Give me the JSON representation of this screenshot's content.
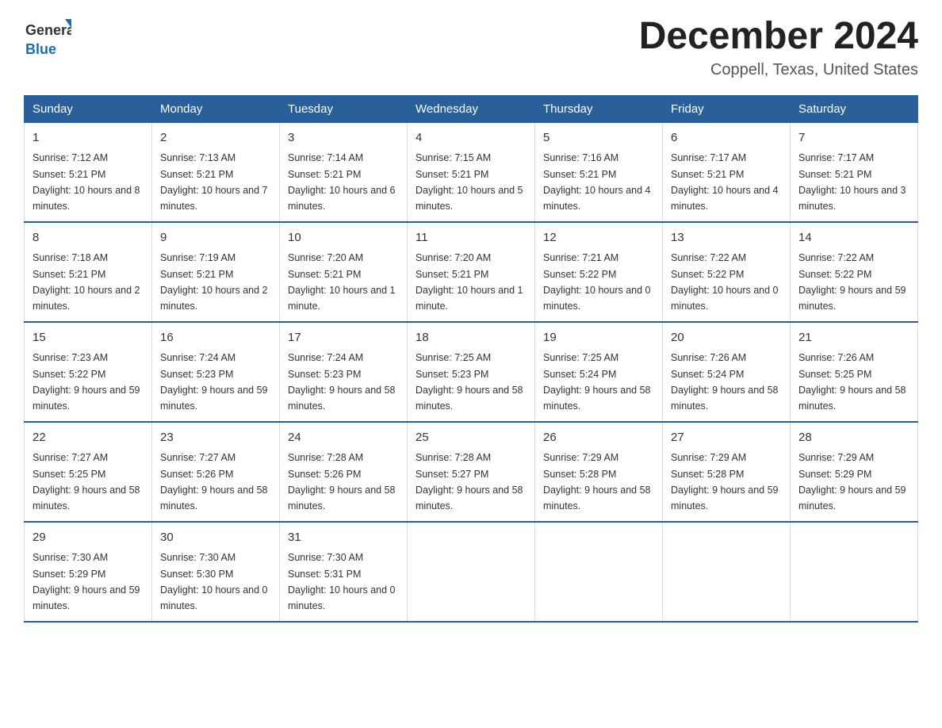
{
  "logo": {
    "general": "General",
    "blue": "Blue"
  },
  "title": {
    "month_year": "December 2024",
    "location": "Coppell, Texas, United States"
  },
  "header": {
    "days": [
      "Sunday",
      "Monday",
      "Tuesday",
      "Wednesday",
      "Thursday",
      "Friday",
      "Saturday"
    ]
  },
  "weeks": [
    [
      {
        "day": "1",
        "sunrise": "Sunrise: 7:12 AM",
        "sunset": "Sunset: 5:21 PM",
        "daylight": "Daylight: 10 hours and 8 minutes."
      },
      {
        "day": "2",
        "sunrise": "Sunrise: 7:13 AM",
        "sunset": "Sunset: 5:21 PM",
        "daylight": "Daylight: 10 hours and 7 minutes."
      },
      {
        "day": "3",
        "sunrise": "Sunrise: 7:14 AM",
        "sunset": "Sunset: 5:21 PM",
        "daylight": "Daylight: 10 hours and 6 minutes."
      },
      {
        "day": "4",
        "sunrise": "Sunrise: 7:15 AM",
        "sunset": "Sunset: 5:21 PM",
        "daylight": "Daylight: 10 hours and 5 minutes."
      },
      {
        "day": "5",
        "sunrise": "Sunrise: 7:16 AM",
        "sunset": "Sunset: 5:21 PM",
        "daylight": "Daylight: 10 hours and 4 minutes."
      },
      {
        "day": "6",
        "sunrise": "Sunrise: 7:17 AM",
        "sunset": "Sunset: 5:21 PM",
        "daylight": "Daylight: 10 hours and 4 minutes."
      },
      {
        "day": "7",
        "sunrise": "Sunrise: 7:17 AM",
        "sunset": "Sunset: 5:21 PM",
        "daylight": "Daylight: 10 hours and 3 minutes."
      }
    ],
    [
      {
        "day": "8",
        "sunrise": "Sunrise: 7:18 AM",
        "sunset": "Sunset: 5:21 PM",
        "daylight": "Daylight: 10 hours and 2 minutes."
      },
      {
        "day": "9",
        "sunrise": "Sunrise: 7:19 AM",
        "sunset": "Sunset: 5:21 PM",
        "daylight": "Daylight: 10 hours and 2 minutes."
      },
      {
        "day": "10",
        "sunrise": "Sunrise: 7:20 AM",
        "sunset": "Sunset: 5:21 PM",
        "daylight": "Daylight: 10 hours and 1 minute."
      },
      {
        "day": "11",
        "sunrise": "Sunrise: 7:20 AM",
        "sunset": "Sunset: 5:21 PM",
        "daylight": "Daylight: 10 hours and 1 minute."
      },
      {
        "day": "12",
        "sunrise": "Sunrise: 7:21 AM",
        "sunset": "Sunset: 5:22 PM",
        "daylight": "Daylight: 10 hours and 0 minutes."
      },
      {
        "day": "13",
        "sunrise": "Sunrise: 7:22 AM",
        "sunset": "Sunset: 5:22 PM",
        "daylight": "Daylight: 10 hours and 0 minutes."
      },
      {
        "day": "14",
        "sunrise": "Sunrise: 7:22 AM",
        "sunset": "Sunset: 5:22 PM",
        "daylight": "Daylight: 9 hours and 59 minutes."
      }
    ],
    [
      {
        "day": "15",
        "sunrise": "Sunrise: 7:23 AM",
        "sunset": "Sunset: 5:22 PM",
        "daylight": "Daylight: 9 hours and 59 minutes."
      },
      {
        "day": "16",
        "sunrise": "Sunrise: 7:24 AM",
        "sunset": "Sunset: 5:23 PM",
        "daylight": "Daylight: 9 hours and 59 minutes."
      },
      {
        "day": "17",
        "sunrise": "Sunrise: 7:24 AM",
        "sunset": "Sunset: 5:23 PM",
        "daylight": "Daylight: 9 hours and 58 minutes."
      },
      {
        "day": "18",
        "sunrise": "Sunrise: 7:25 AM",
        "sunset": "Sunset: 5:23 PM",
        "daylight": "Daylight: 9 hours and 58 minutes."
      },
      {
        "day": "19",
        "sunrise": "Sunrise: 7:25 AM",
        "sunset": "Sunset: 5:24 PM",
        "daylight": "Daylight: 9 hours and 58 minutes."
      },
      {
        "day": "20",
        "sunrise": "Sunrise: 7:26 AM",
        "sunset": "Sunset: 5:24 PM",
        "daylight": "Daylight: 9 hours and 58 minutes."
      },
      {
        "day": "21",
        "sunrise": "Sunrise: 7:26 AM",
        "sunset": "Sunset: 5:25 PM",
        "daylight": "Daylight: 9 hours and 58 minutes."
      }
    ],
    [
      {
        "day": "22",
        "sunrise": "Sunrise: 7:27 AM",
        "sunset": "Sunset: 5:25 PM",
        "daylight": "Daylight: 9 hours and 58 minutes."
      },
      {
        "day": "23",
        "sunrise": "Sunrise: 7:27 AM",
        "sunset": "Sunset: 5:26 PM",
        "daylight": "Daylight: 9 hours and 58 minutes."
      },
      {
        "day": "24",
        "sunrise": "Sunrise: 7:28 AM",
        "sunset": "Sunset: 5:26 PM",
        "daylight": "Daylight: 9 hours and 58 minutes."
      },
      {
        "day": "25",
        "sunrise": "Sunrise: 7:28 AM",
        "sunset": "Sunset: 5:27 PM",
        "daylight": "Daylight: 9 hours and 58 minutes."
      },
      {
        "day": "26",
        "sunrise": "Sunrise: 7:29 AM",
        "sunset": "Sunset: 5:28 PM",
        "daylight": "Daylight: 9 hours and 58 minutes."
      },
      {
        "day": "27",
        "sunrise": "Sunrise: 7:29 AM",
        "sunset": "Sunset: 5:28 PM",
        "daylight": "Daylight: 9 hours and 59 minutes."
      },
      {
        "day": "28",
        "sunrise": "Sunrise: 7:29 AM",
        "sunset": "Sunset: 5:29 PM",
        "daylight": "Daylight: 9 hours and 59 minutes."
      }
    ],
    [
      {
        "day": "29",
        "sunrise": "Sunrise: 7:30 AM",
        "sunset": "Sunset: 5:29 PM",
        "daylight": "Daylight: 9 hours and 59 minutes."
      },
      {
        "day": "30",
        "sunrise": "Sunrise: 7:30 AM",
        "sunset": "Sunset: 5:30 PM",
        "daylight": "Daylight: 10 hours and 0 minutes."
      },
      {
        "day": "31",
        "sunrise": "Sunrise: 7:30 AM",
        "sunset": "Sunset: 5:31 PM",
        "daylight": "Daylight: 10 hours and 0 minutes."
      },
      null,
      null,
      null,
      null
    ]
  ]
}
